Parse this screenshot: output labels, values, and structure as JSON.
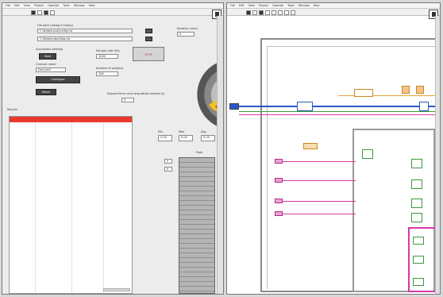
{
  "front_panel": {
    "menu": [
      "File",
      "Edit",
      "View",
      "Project",
      "Operate",
      "Tools",
      "Window",
      "Help"
    ],
    "file_path_label": "File path (dialog if empty)",
    "file_path_value_1": "C:\\Data\\input\\config.txt",
    "file_path_value_2": "C:\\Data\\output\\log.txt",
    "top_right_label": "Iteration count",
    "top_right_value": "0",
    "stop_button_label": "STOP",
    "left_group_label": "Acquisition settings",
    "left_button_label": "Start",
    "left_field_label": "Channel name",
    "left_field_value": "Dev1/ai0",
    "left_button2_label": "Configure",
    "left_button3_label": "Reset",
    "mid_label_1": "Sample rate (Hz)",
    "mid_value_1": "1000",
    "mid_label_2": "Number of samples",
    "mid_value_2": "100",
    "center_label": "Elapsed time since acquisition started (s)",
    "center_value": "0",
    "table_label": "Results",
    "small_box_label_1": "Min",
    "small_box_value_1": "0.00",
    "small_box_label_2": "Max",
    "small_box_value_2": "0.00",
    "small_box_label_3": "Avg",
    "small_box_value_3": "0.00",
    "array_label": "Data",
    "array_index_1": "0",
    "array_index_2": "0"
  },
  "block_diagram": {
    "menu": [
      "File",
      "Edit",
      "View",
      "Project",
      "Operate",
      "Tools",
      "Window",
      "Help"
    ]
  }
}
